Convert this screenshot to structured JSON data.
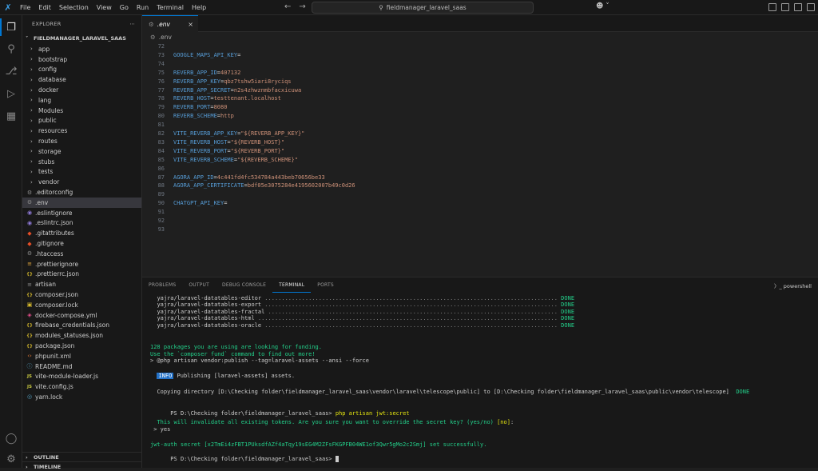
{
  "titlebar": {
    "menu": [
      "File",
      "Edit",
      "Selection",
      "View",
      "Go",
      "Run",
      "Terminal",
      "Help"
    ],
    "search_text": "fieldmanager_laravel_saas"
  },
  "explorer": {
    "header": "EXPLORER",
    "root": "FIELDMANAGER_LARAVEL_SAAS",
    "folders": [
      "app",
      "bootstrap",
      "config",
      "database",
      "docker",
      "lang",
      "Modules",
      "public",
      "resources",
      "routes",
      "storage",
      "stubs",
      "tests",
      "vendor"
    ],
    "files": [
      {
        "name": ".editorconfig",
        "icon": "gear-icon",
        "color": "#8a8a8a"
      },
      {
        "name": ".env",
        "icon": "gear-icon",
        "color": "#8a8a8a",
        "selected": true
      },
      {
        "name": ".eslintignore",
        "icon": "eslint-icon",
        "color": "#8e79d6"
      },
      {
        "name": ".eslintrc.json",
        "icon": "eslint-icon",
        "color": "#8e79d6"
      },
      {
        "name": ".gitattributes",
        "icon": "git-icon",
        "color": "#e44d26"
      },
      {
        "name": ".gitignore",
        "icon": "git-icon",
        "color": "#e44d26"
      },
      {
        "name": ".htaccess",
        "icon": "gear-icon",
        "color": "#8a8a8a"
      },
      {
        "name": ".prettierignore",
        "icon": "prettier-icon",
        "color": "#e0a53a"
      },
      {
        "name": ".prettierrc.json",
        "icon": "json-icon",
        "color": "#d7ba2c"
      },
      {
        "name": "artisan",
        "icon": "file-icon",
        "color": "#8a8a8a"
      },
      {
        "name": "composer.json",
        "icon": "json-icon",
        "color": "#d7ba2c"
      },
      {
        "name": "composer.lock",
        "icon": "lock-icon",
        "color": "#d7ba2c"
      },
      {
        "name": "docker-compose.yml",
        "icon": "docker-icon",
        "color": "#e44d8a"
      },
      {
        "name": "firebase_credentials.json",
        "icon": "json-icon",
        "color": "#d7ba2c"
      },
      {
        "name": "modules_statuses.json",
        "icon": "json-icon",
        "color": "#d7ba2c"
      },
      {
        "name": "package.json",
        "icon": "json-icon",
        "color": "#d7ba2c"
      },
      {
        "name": "phpunit.xml",
        "icon": "xml-icon",
        "color": "#e37933"
      },
      {
        "name": "README.md",
        "icon": "info-icon",
        "color": "#519aba"
      },
      {
        "name": "vite-module-loader.js",
        "icon": "js-icon",
        "color": "#cbcb41"
      },
      {
        "name": "vite.config.js",
        "icon": "js-icon",
        "color": "#cbcb41"
      },
      {
        "name": "yarn.lock",
        "icon": "yarn-icon",
        "color": "#519aba"
      }
    ],
    "outline": "OUTLINE",
    "timeline": "TIMELINE"
  },
  "editor": {
    "tab": ".env",
    "breadcrumb": ".env",
    "lines": [
      {
        "n": "72",
        "key": "",
        "val": ""
      },
      {
        "n": "73",
        "key": "GOOGLE_MAPS_API_KEY",
        "val": ""
      },
      {
        "n": "74",
        "key": "",
        "val": ""
      },
      {
        "n": "75",
        "key": "REVERB_APP_ID",
        "val": "407132"
      },
      {
        "n": "76",
        "key": "REVERB_APP_KEY",
        "val": "qbz7tshw5iari8ryciqs"
      },
      {
        "n": "77",
        "key": "REVERB_APP_SECRET",
        "val": "n2s4zhwznmbfacxicuwa"
      },
      {
        "n": "78",
        "key": "REVERB_HOST",
        "val": "testtenant.localhost"
      },
      {
        "n": "79",
        "key": "REVERB_PORT",
        "val": "8080"
      },
      {
        "n": "80",
        "key": "REVERB_SCHEME",
        "val": "http"
      },
      {
        "n": "81",
        "key": "",
        "val": ""
      },
      {
        "n": "82",
        "key": "VITE_REVERB_APP_KEY",
        "val": "\"${REVERB_APP_KEY}\""
      },
      {
        "n": "83",
        "key": "VITE_REVERB_HOST",
        "val": "\"${REVERB_HOST}\""
      },
      {
        "n": "84",
        "key": "VITE_REVERB_PORT",
        "val": "\"${REVERB_PORT}\""
      },
      {
        "n": "85",
        "key": "VITE_REVERB_SCHEME",
        "val": "\"${REVERB_SCHEME}\""
      },
      {
        "n": "86",
        "key": "",
        "val": ""
      },
      {
        "n": "87",
        "key": "AGORA_APP_ID",
        "val": "4c441fd4fc534784a443beb70656be33"
      },
      {
        "n": "88",
        "key": "AGORA_APP_CERTIFICATE",
        "val": "bdf05e3075284e4195602007b49c0d26"
      },
      {
        "n": "89",
        "key": "",
        "val": ""
      },
      {
        "n": "90",
        "key": "CHATGPT_API_KEY",
        "val": ""
      },
      {
        "n": "91",
        "key": "",
        "val": ""
      },
      {
        "n": "92",
        "key": "",
        "val": ""
      },
      {
        "n": "93",
        "key": "",
        "val": ""
      }
    ]
  },
  "panel": {
    "tabs": [
      "PROBLEMS",
      "OUTPUT",
      "DEBUG CONSOLE",
      "TERMINAL",
      "PORTS"
    ],
    "active_tab": "TERMINAL",
    "shell": "powershell"
  },
  "terminal": {
    "packages": [
      "yajra/laravel-datatables-editor",
      "yajra/laravel-datatables-export",
      "yajra/laravel-datatables-fractal",
      "yajra/laravel-datatables-html",
      "yajra/laravel-datatables-oracle"
    ],
    "done": "DONE",
    "funding1": "128 packages you are using are looking for funding.",
    "funding2": "Use the `composer fund` command to find out more!",
    "publish_cmd": "> @php artisan vendor:publish --tag=laravel-assets --ansi --force",
    "info_badge": "INFO",
    "publishing_pre": "Publishing ",
    "publishing_tag": "[laravel-assets]",
    "publishing_post": " assets.",
    "copying": "Copying directory [D:\\Checking folder\\fieldmanager_laravel_saas\\vendor\\laravel\\telescope\\public] to [D:\\Checking folder\\fieldmanager_laravel_saas\\public\\vendor\\telescope]",
    "prompt1": "PS D:\\Checking folder\\fieldmanager_laravel_saas> ",
    "cmd1": "php artisan jwt:secret",
    "warn": "This will invalidate all existing tokens. Are you sure you want to override the secret key? (yes/no)",
    "warn_default": " [no]",
    "warn_colon": ":",
    "answer": " > yes",
    "result": "jwt-auth secret [x2TmEi4zFBT1PUksdfAZf4aTqy19sEG4M2ZFsFKGPFB04WE1of3Qwr5gMo2c2Smj] set successfully.",
    "prompt2": "PS D:\\Checking folder\\fieldmanager_laravel_saas> "
  }
}
